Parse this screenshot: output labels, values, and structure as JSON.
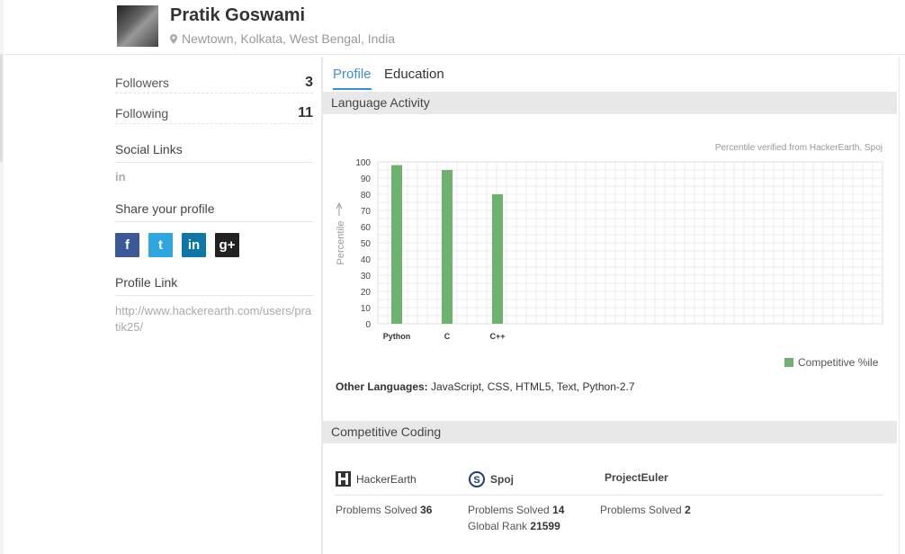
{
  "profile": {
    "name": "Pratik Goswami",
    "location": "Newtown, Kolkata, West Bengal, India"
  },
  "sidebar": {
    "followers_label": "Followers",
    "followers_count": "3",
    "following_label": "Following",
    "following_count": "11",
    "social_links_heading": "Social Links",
    "social_linkedin_icon": "in",
    "share_heading": "Share your profile",
    "share_buttons": [
      {
        "icon": "facebook-icon",
        "glyph": "f",
        "color": "#3b5998"
      },
      {
        "icon": "twitter-icon",
        "glyph": "t",
        "color": "#2ea7e0"
      },
      {
        "icon": "linkedin-icon",
        "glyph": "in",
        "color": "#0e76a8"
      },
      {
        "icon": "googleplus-icon",
        "glyph": "g+",
        "color": "#222222"
      }
    ],
    "profile_link_heading": "Profile Link",
    "profile_link": "http://www.hackerearth.com/users/pratik25/"
  },
  "tabs": [
    {
      "label": "Profile",
      "active": true
    },
    {
      "label": "Education",
      "active": false
    }
  ],
  "language_activity": {
    "heading": "Language Activity",
    "verified_note": "Percentile verified from HackerEarth, Spoj",
    "legend": "Competitive %ile",
    "other_languages_label": "Other Languages:",
    "other_languages": "JavaScript, CSS, HTML5, Text, Python-2.7"
  },
  "chart_data": {
    "type": "bar",
    "categories": [
      "Python",
      "C",
      "C++"
    ],
    "series": [
      {
        "name": "Competitive %ile",
        "values": [
          98,
          95,
          80
        ],
        "color": "#6db36d"
      }
    ],
    "ylabel": "Percentile",
    "ylim": [
      0,
      100
    ],
    "yticks": [
      0,
      10,
      20,
      30,
      40,
      50,
      60,
      70,
      80,
      90,
      100
    ],
    "grid": true,
    "legend_position": "bottom-right"
  },
  "competitive_coding": {
    "heading": "Competitive Coding",
    "platforms": [
      {
        "name": "HackerEarth",
        "icon": "hackerearth-icon",
        "problems_label": "Problems Solved",
        "problems": "36"
      },
      {
        "name": "Spoj",
        "icon": "spoj-icon",
        "problems_label": "Problems Solved",
        "problems": "14",
        "rank_label": "Global Rank",
        "rank": "21599"
      },
      {
        "name": "ProjectEuler",
        "icon": "",
        "problems_label": "Problems Solved",
        "problems": "2"
      }
    ]
  }
}
